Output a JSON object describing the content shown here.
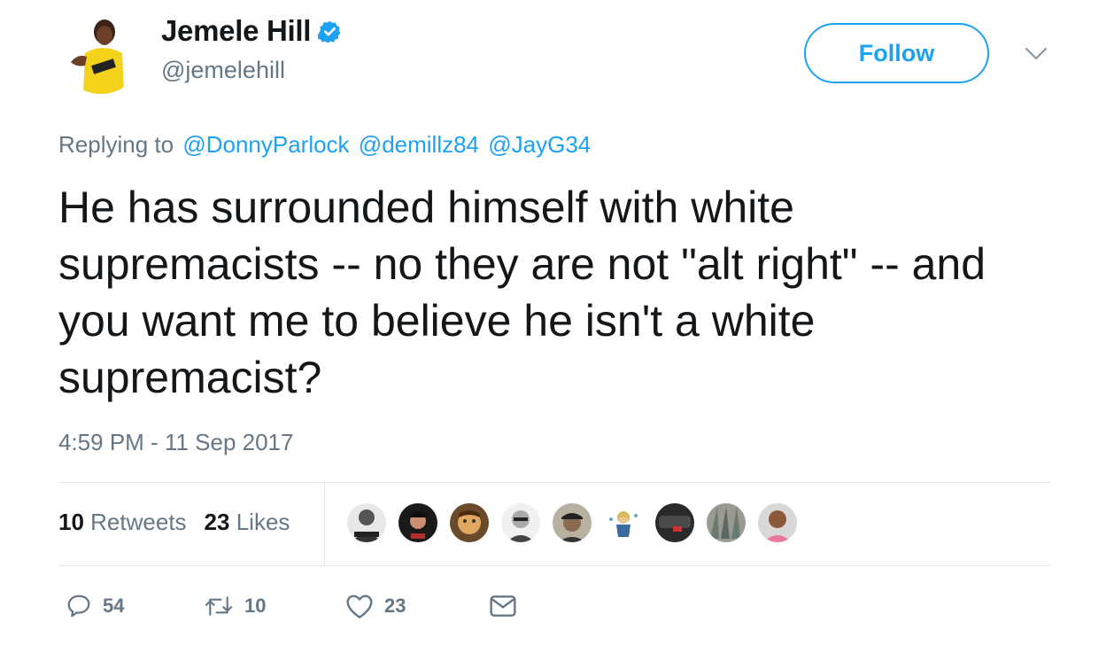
{
  "author": {
    "name": "Jemele Hill",
    "handle": "@jemelehill",
    "verified": true
  },
  "header": {
    "follow_label": "Follow"
  },
  "reply": {
    "prefix": "Replying to",
    "mentions": [
      "@DonnyParlock",
      "@demillz84",
      "@JayG34"
    ]
  },
  "tweet": {
    "text": "He has surrounded himself with white supremacists -- no they are not \"alt right\" -- and you want me to believe he isn't a white supremacist?",
    "timestamp": "4:59 PM - 11 Sep 2017"
  },
  "stats": {
    "retweets_count": "10",
    "retweets_label": "Retweets",
    "likes_count": "23",
    "likes_label": "Likes"
  },
  "likers": [
    {
      "icon": "liker-avatar-1",
      "color": "#4a4a4a"
    },
    {
      "icon": "liker-avatar-2",
      "color": "#2b2b2b"
    },
    {
      "icon": "liker-avatar-3",
      "color": "#8a6a3a"
    },
    {
      "icon": "liker-avatar-4",
      "color": "#9a9a9a"
    },
    {
      "icon": "liker-avatar-5",
      "color": "#6b5a48"
    },
    {
      "icon": "liker-avatar-6",
      "color": "#d8c890"
    },
    {
      "icon": "liker-avatar-7",
      "color": "#3a3a3a"
    },
    {
      "icon": "liker-avatar-8",
      "color": "#8a8a8a"
    },
    {
      "icon": "liker-avatar-9",
      "color": "#b08060"
    }
  ],
  "actions": {
    "reply_count": "54",
    "retweet_count": "10",
    "like_count": "23"
  },
  "colors": {
    "accent": "#1da1f2",
    "muted": "#657786",
    "text": "#14171a"
  }
}
